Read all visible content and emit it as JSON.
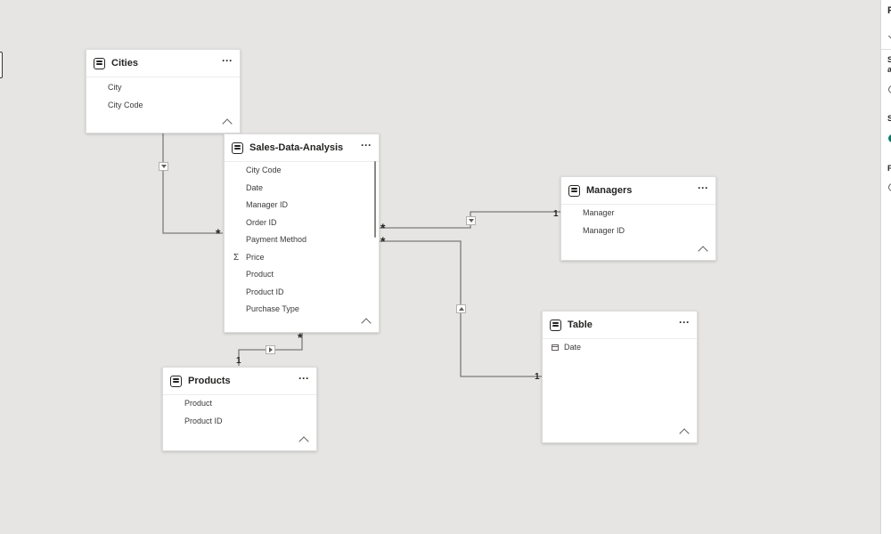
{
  "tables": {
    "cities": {
      "title": "Cities",
      "fields": [
        "City",
        "City Code"
      ]
    },
    "sales": {
      "title": "Sales-Data-Analysis",
      "fields": [
        "City Code",
        "Date",
        "Manager ID",
        "Order ID",
        "Payment Method",
        "Price",
        "Product",
        "Product ID",
        "Purchase Type"
      ]
    },
    "managers": {
      "title": "Managers",
      "fields": [
        "Manager",
        "Manager ID"
      ]
    },
    "table": {
      "title": "Table",
      "fields": [
        "Date"
      ]
    },
    "products": {
      "title": "Products",
      "fields": [
        "Product",
        "Product ID"
      ]
    }
  },
  "relationships": {
    "many": "*",
    "one": "1"
  },
  "more_label": "···",
  "right_panel": {
    "title": "P",
    "label_1": "S",
    "label_1b": "a",
    "label_2": "S",
    "label_3": "P"
  },
  "colors": {
    "canvas": "#e6e5e4",
    "toggle_on": "#117865",
    "line": "#7a7a7a"
  }
}
